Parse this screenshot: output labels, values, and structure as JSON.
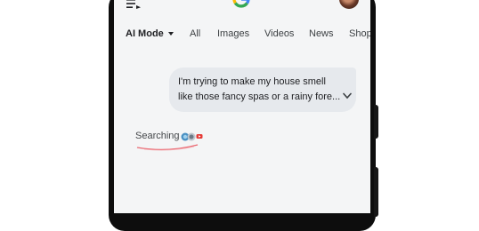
{
  "tabs": [
    {
      "label": "AI Mode",
      "active": true
    },
    {
      "label": "All"
    },
    {
      "label": "Images"
    },
    {
      "label": "Videos"
    },
    {
      "label": "News"
    },
    {
      "label": "Shop"
    }
  ],
  "icons": {
    "history": "history-menu-icon",
    "logo": "google-g-logo",
    "avatar": "profile-avatar",
    "expand": "chevron-down-icon"
  },
  "chat": {
    "user_message": "I'm trying to make my house smell like those fancy spas or a rainy fore..."
  },
  "status": {
    "text": "Searching"
  },
  "colors": {
    "screen_bg": "#f4f5f6",
    "bubble_bg": "#e6e9ed",
    "accent_red": "#e8505b"
  }
}
